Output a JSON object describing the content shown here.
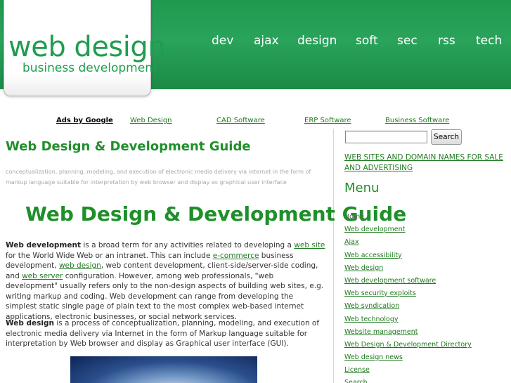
{
  "logo": {
    "title": "web design",
    "subtitle": "business development"
  },
  "topnav": [
    "dev",
    "ajax",
    "design",
    "soft",
    "sec",
    "rss",
    "tech"
  ],
  "ads": {
    "label": "Ads by Google",
    "links": [
      "Web Design",
      "CAD Software",
      "ERP Software",
      "Business Software"
    ]
  },
  "main": {
    "title": "Web Design & Development Guide",
    "tagline": "conceptualization, planning, modeling, and execution of electronic media delivery via internet in the form of markup language suitable for interpretation by web browser and display as graphical user interface",
    "big_title": "Web Design & Development Guide",
    "p1": {
      "b1": "Web development",
      "t1": " is a broad term for any activities related to developing a ",
      "l1": "web site",
      "t2": " for the World Wide Web or an intranet. This can include ",
      "l2": "e-commerce",
      "t3": " business development, ",
      "l3": "web design",
      "t4": ", web content development, client-side/server-side coding, and ",
      "l4": "web server",
      "t5": " configuration. However, among web professionals, \"web development\" usually refers only to the non-design aspects of building web sites, e.g. writing markup and coding. Web development can range from developing the simplest static single page of plain text to the most complex web-based internet applications, electronic businesses, or social network services."
    },
    "p2": {
      "b1": "Web design",
      "t1": " is a process of conceptualization, planning, modeling, and execution of electronic media delivery via Internet in the form of Markup language suitable for interpretation by Web browser and display as Graphical user interface (GUI)."
    }
  },
  "sidebar": {
    "search_button": "Search",
    "search_value": "",
    "sale_link": "WEB SITES AND DOMAIN NAMES FOR SALE AND ADVERTISING",
    "menu_heading": "Menu",
    "menu_items": [
      "Home",
      "Web development",
      "Ajax",
      "Web accessibility",
      "Web design",
      "Web development software",
      "Web security exploits",
      "Web syndication",
      "Web technology",
      "Website management",
      "Web Design & Development Directory",
      "Web design news",
      "License",
      "Search"
    ]
  },
  "colors": {
    "header_green": "#1e9a4f",
    "title_green": "#1f8f2a",
    "link_green": "#1f7a1f"
  }
}
